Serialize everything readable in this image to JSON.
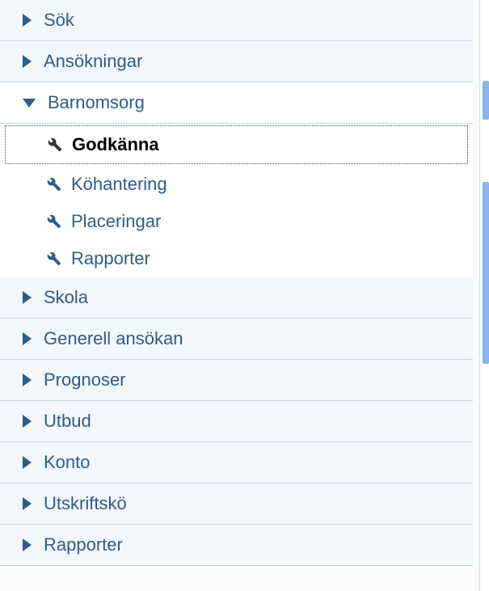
{
  "nav": {
    "items": [
      {
        "label": "Sök",
        "expanded": false
      },
      {
        "label": "Ansökningar",
        "expanded": false
      },
      {
        "label": "Barnomsorg",
        "expanded": true,
        "children": [
          {
            "label": "Godkänna",
            "selected": true
          },
          {
            "label": "Köhantering",
            "selected": false
          },
          {
            "label": "Placeringar",
            "selected": false
          },
          {
            "label": "Rapporter",
            "selected": false
          }
        ]
      },
      {
        "label": "Skola",
        "expanded": false
      },
      {
        "label": "Generell ansökan",
        "expanded": false
      },
      {
        "label": "Prognoser",
        "expanded": false
      },
      {
        "label": "Utbud",
        "expanded": false
      },
      {
        "label": "Konto",
        "expanded": false
      },
      {
        "label": "Utskriftskö",
        "expanded": false
      },
      {
        "label": "Rapporter",
        "expanded": false
      }
    ]
  }
}
